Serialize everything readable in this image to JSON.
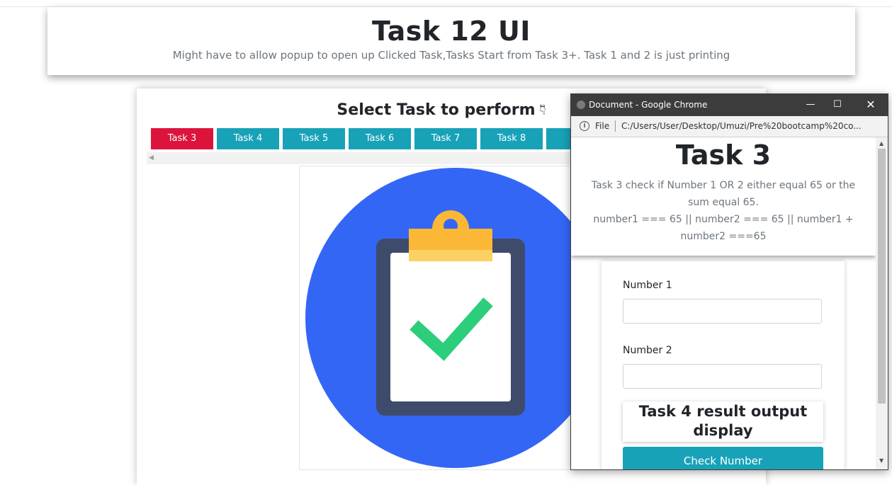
{
  "header": {
    "title": "Task 12 UI",
    "subtitle": "Might have to allow popup to open up Clicked Task,Tasks Start from Task 3+. Task 1 and 2 is just printing"
  },
  "main": {
    "heading": "Select Task to perform",
    "heading_icon": "pointing-down-hand-icon",
    "tabs": [
      {
        "label": "Task 3",
        "active": true
      },
      {
        "label": "Task 4"
      },
      {
        "label": "Task 5"
      },
      {
        "label": "Task 6"
      },
      {
        "label": "Task 7"
      },
      {
        "label": "Task 8"
      },
      {
        "label": "Ta"
      }
    ],
    "image_icon": "clipboard-check-icon"
  },
  "popup": {
    "window_title": "Document - Google Chrome",
    "file_label": "File",
    "url": "C:/Users/User/Desktop/Umuzi/Pre%20bootcamp%20co...",
    "task_title": "Task 3",
    "task_desc_line1": "Task 3 check if Number 1 OR 2 either equal 65 or the sum equal 65.",
    "task_desc_line2": "number1 === 65 || number2 === 65 || number1 + number2 ===65",
    "number1_label": "Number 1",
    "number1_value": "",
    "number2_label": "Number 2",
    "number2_value": "",
    "result_label": "Task 4 result output display",
    "check_button": "Check Number"
  },
  "colors": {
    "active_tab": "#dc143c",
    "tab": "#17a2b8",
    "button": "#17a2b8",
    "image_circle": "#3466f6",
    "clipboard": "#3f4b6b",
    "clip": "#fbb836",
    "check": "#2ccd7b"
  }
}
